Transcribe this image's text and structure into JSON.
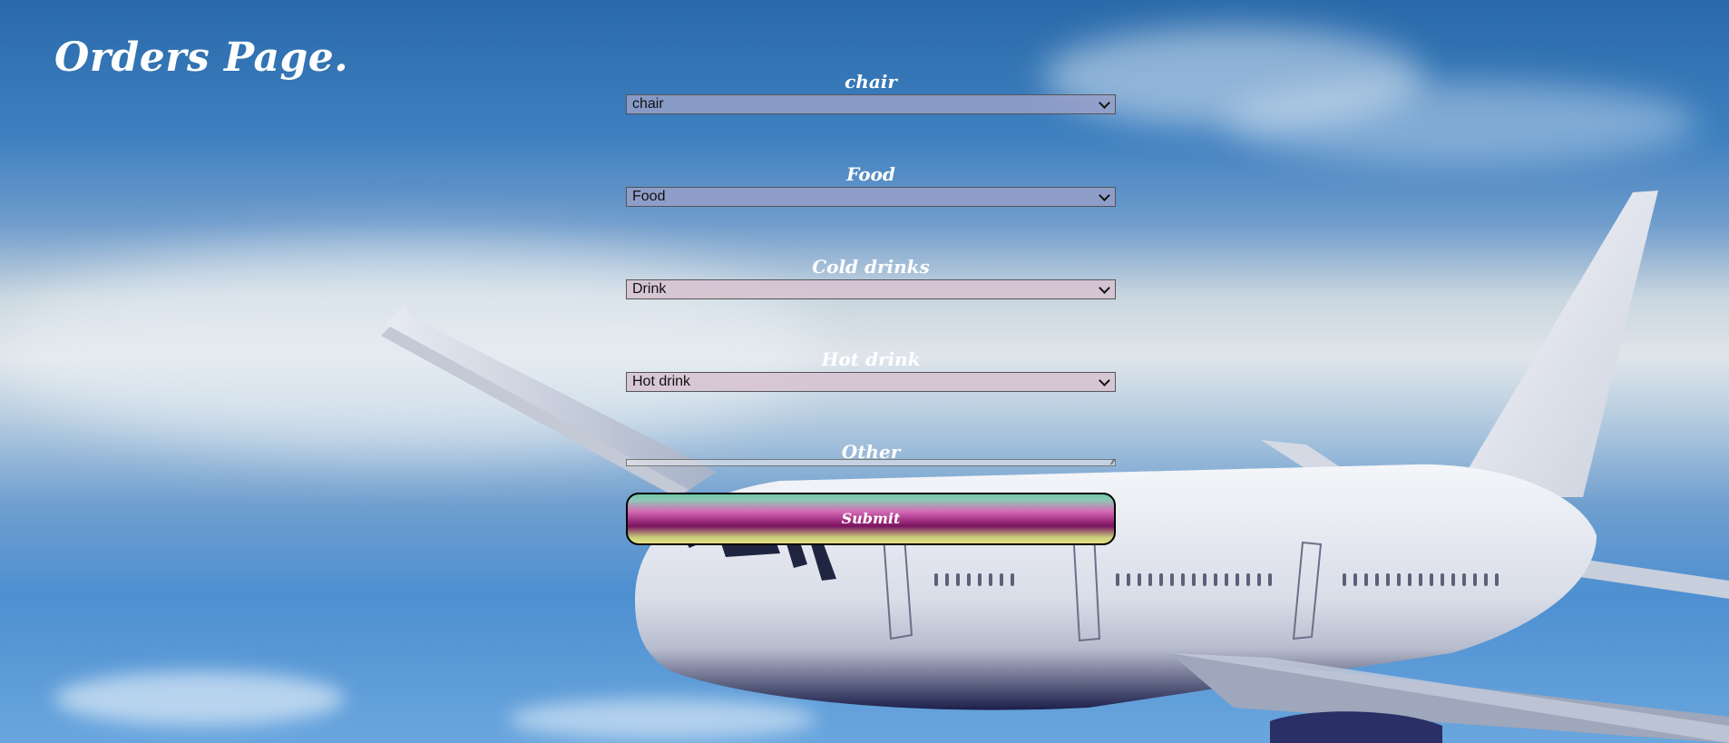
{
  "page": {
    "title": "Orders Page."
  },
  "form": {
    "fields": [
      {
        "label": "chair",
        "selected": "chair"
      },
      {
        "label": "Food",
        "selected": "Food"
      },
      {
        "label": "Cold drinks",
        "selected": "Drink"
      },
      {
        "label": "Hot drink",
        "selected": "Hot drink"
      }
    ],
    "other": {
      "label": "Other",
      "value": ""
    },
    "submit_label": "Submit"
  },
  "colors": {
    "sky_top": "#2a6aaa",
    "text": "#ffffff",
    "select_blue": "#969fc8",
    "select_pink": "#d7c3d2",
    "button_gradient_mid": "#9a2a7a"
  },
  "icons": {
    "select_arrow": "chevron-down-icon",
    "textarea_grip": "resize-grip-icon"
  }
}
